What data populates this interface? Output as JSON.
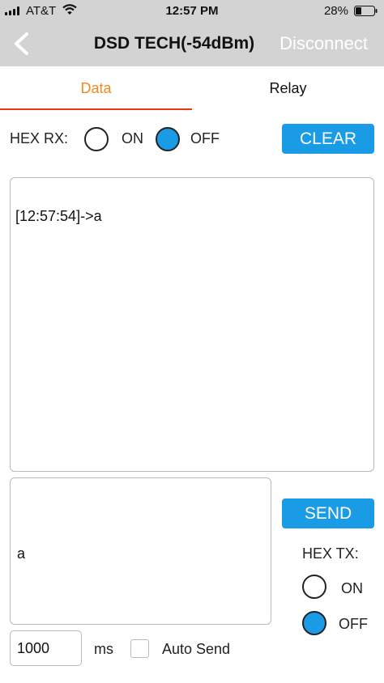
{
  "status_bar": {
    "carrier": "AT&T",
    "time": "12:57 PM",
    "battery_percent": "28%"
  },
  "nav": {
    "title": "DSD TECH(-54dBm)",
    "disconnect_label": "Disconnect"
  },
  "tabs": [
    {
      "label": "Data",
      "active": true
    },
    {
      "label": "Relay",
      "active": false
    }
  ],
  "hex_rx": {
    "label": "HEX RX:",
    "on_label": "ON",
    "off_label": "OFF",
    "selected": "OFF"
  },
  "clear_label": "CLEAR",
  "receive_log": "[12:57:54]->a",
  "send_text": "a",
  "send_label": "SEND",
  "hex_tx": {
    "label": "HEX TX:",
    "on_label": "ON",
    "off_label": "OFF",
    "selected": "OFF"
  },
  "auto_send": {
    "interval_value": "1000",
    "unit": "ms",
    "label": "Auto Send",
    "checked": false
  },
  "colors": {
    "accent_blue": "#1a9be6",
    "tab_active": "#f08a1c",
    "tab_underline": "#e8361c",
    "bar_gray": "#d3d3d3"
  }
}
